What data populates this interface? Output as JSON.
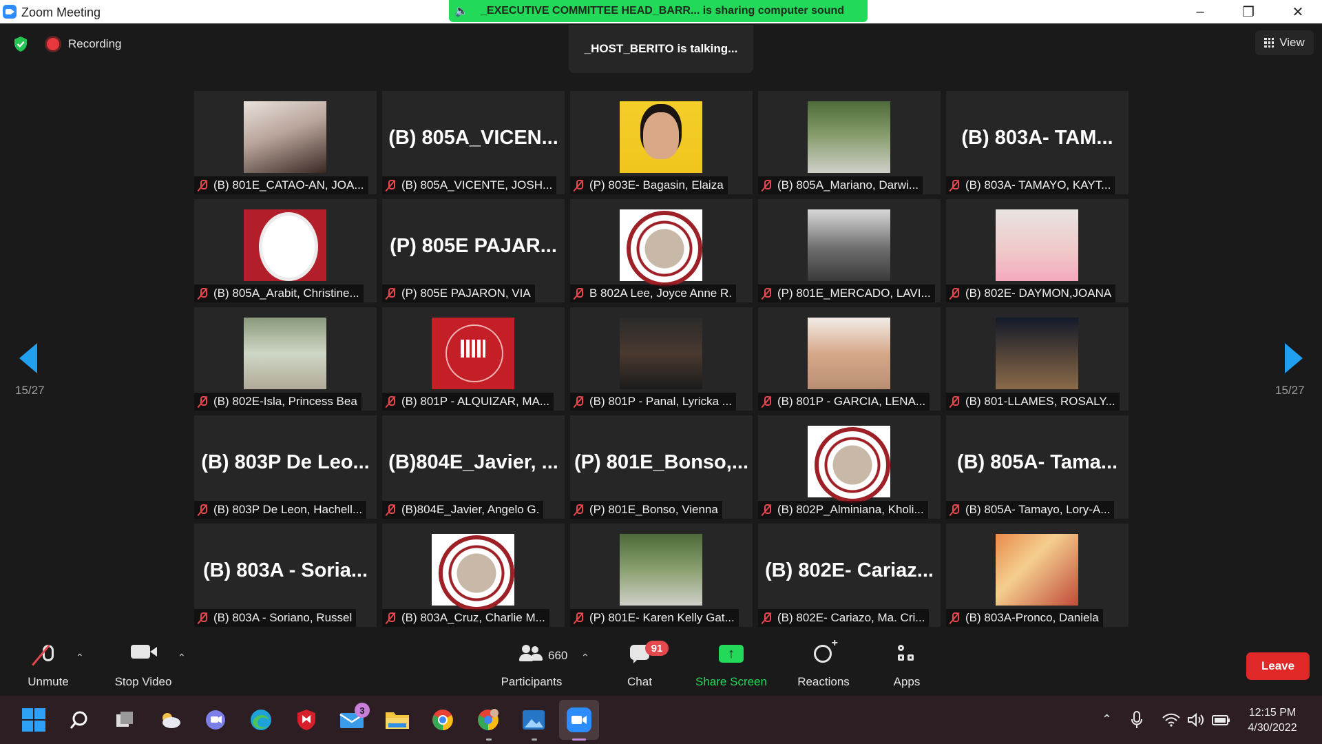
{
  "window": {
    "title": "Zoom Meeting",
    "share_banner": "_EXECUTIVE COMMITTEE HEAD_BARR... is sharing computer sound"
  },
  "top": {
    "recording_label": "Recording",
    "talking": "_HOST_BERITO is talking...",
    "view_label": "View"
  },
  "pagination": {
    "left": "15/27",
    "right": "15/27"
  },
  "participants": [
    {
      "name": "(B) 801E_CATAO-AN, JOA...",
      "display": "",
      "photo": "skin"
    },
    {
      "name": "(B) 805A_VICENTE, JOSH...",
      "display": "(B)  805A_VICEN...",
      "photo": ""
    },
    {
      "name": "(P) 803E- Bagasin, Elaiza",
      "display": "",
      "photo": "yellow"
    },
    {
      "name": "(B) 805A_Mariano, Darwi...",
      "display": "",
      "photo": "park"
    },
    {
      "name": "(B) 803A- TAMAYO, KAYT...",
      "display": "(B)  803A-  TAM...",
      "photo": ""
    },
    {
      "name": "(B) 805A_Arabit, Christine...",
      "display": "",
      "photo": "roserb"
    },
    {
      "name": "(P) 805E PAJARON, VIA",
      "display": "(P)  805E  PAJAR...",
      "photo": ""
    },
    {
      "name": "B 802A Lee, Joyce Anne R.",
      "display": "",
      "photo": "circle"
    },
    {
      "name": "(P) 801E_MERCADO, LAVI...",
      "display": "",
      "photo": "gray"
    },
    {
      "name": "(B) 802E- DAYMON,JOANA",
      "display": "",
      "photo": "pink"
    },
    {
      "name": "(B) 802E-Isla, Princess Bea",
      "display": "",
      "photo": "green"
    },
    {
      "name": "(B) 801P - ALQUIZAR, MA...",
      "display": "",
      "photo": "redlogo"
    },
    {
      "name": "(B) 801P - Panal, Lyricka ...",
      "display": "",
      "photo": "dark"
    },
    {
      "name": "(B) 801P - GARCIA, LENA...",
      "display": "",
      "photo": "face"
    },
    {
      "name": "(B) 801-LLAMES, ROSALY...",
      "display": "",
      "photo": "night"
    },
    {
      "name": "(B) 803P De Leon, Hachell...",
      "display": "(B)  803P  De  Leo...",
      "photo": ""
    },
    {
      "name": "(B)804E_Javier, Angelo G.",
      "display": "(B)804E_Javier, ...",
      "photo": ""
    },
    {
      "name": "(P) 801E_Bonso, Vienna",
      "display": "(P)  801E_Bonso,...",
      "photo": ""
    },
    {
      "name": "(B) 802P_Alminiana, Kholi...",
      "display": "",
      "photo": "circle"
    },
    {
      "name": "(B) 805A- Tamayo, Lory-A...",
      "display": "(B)  805A-  Tama...",
      "photo": ""
    },
    {
      "name": "(B) 803A - Soriano, Russel",
      "display": "(B)  803A  -  Soria...",
      "photo": ""
    },
    {
      "name": "(B) 803A_Cruz, Charlie M...",
      "display": "",
      "photo": "circle"
    },
    {
      "name": "(P) 801E- Karen Kelly Gat...",
      "display": "",
      "photo": "park"
    },
    {
      "name": "(B) 802E- Cariazo, Ma. Cri...",
      "display": "(B)  802E-  Cariaz...",
      "photo": ""
    },
    {
      "name": "(B) 803A-Pronco, Daniela",
      "display": "",
      "photo": "flower"
    }
  ],
  "toolbar": {
    "unmute": "Unmute",
    "stop_video": "Stop Video",
    "participants_count": "660",
    "participants": "Participants",
    "chat": "Chat",
    "chat_badge": "91",
    "share_screen": "Share Screen",
    "reactions": "Reactions",
    "apps": "Apps",
    "leave": "Leave"
  },
  "taskbar": {
    "mail_badge": "3",
    "time": "12:15 PM",
    "date": "4/30/2022"
  },
  "colors": {
    "accent_blue": "#21a0f0",
    "share_green": "#23d959",
    "leave_red": "#e02828",
    "muted_red": "#e5484d"
  }
}
